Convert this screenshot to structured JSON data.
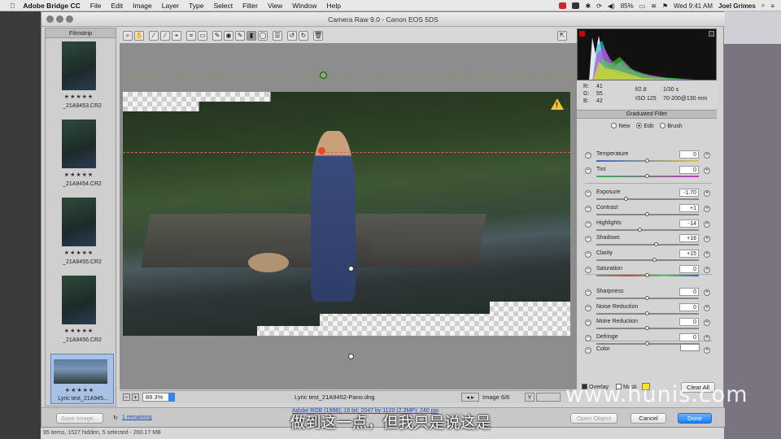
{
  "menubar": {
    "app_name": "Adobe Bridge CC",
    "items": [
      "File",
      "Edit",
      "Image",
      "Layer",
      "Type",
      "Select",
      "Filter",
      "View",
      "Window",
      "Help"
    ],
    "battery": "85%",
    "clock": "Wed 9:41 AM",
    "user": "Joel Grimes"
  },
  "window": {
    "title": "Camera Raw 9.0  -  Canon EOS 5DS"
  },
  "filmstrip": {
    "header": "Filmstrip",
    "items": [
      {
        "name": "_21A9453.CR2",
        "stars": "★★★★★"
      },
      {
        "name": "_21A9454.CR2",
        "stars": "★★★★★"
      },
      {
        "name": "_21A9455.CR2",
        "stars": "★★★★★"
      },
      {
        "name": "_21A9456.CR2",
        "stars": "★★★★★"
      },
      {
        "name": "Lyric test_21A945...",
        "stars": "★★★★★"
      }
    ]
  },
  "statusbar": {
    "zoom": "89.3%",
    "filename": "Lyric test_21A9452-Pano.dng",
    "image_count": "Image 6/6"
  },
  "rgb": {
    "r_label": "R:",
    "r": "41",
    "g_label": "G:",
    "g": "55",
    "b_label": "B:",
    "b": "42",
    "aperture": "f/2.8",
    "shutter": "1/30 s",
    "iso": "ISO 125",
    "lens": "70-200@130 mm"
  },
  "panel": {
    "title": "Graduated Filter",
    "modes": [
      "New",
      "Edit",
      "Brush"
    ],
    "selected_mode": "Edit",
    "sliders": [
      {
        "label": "Temperature",
        "value": "0",
        "pos": 0.5
      },
      {
        "label": "Tint",
        "value": "0",
        "pos": 0.5
      },
      {
        "label": "Exposure",
        "value": "-1.70",
        "pos": 0.29
      },
      {
        "label": "Contrast",
        "value": "+1",
        "pos": 0.5
      },
      {
        "label": "Highlights",
        "value": "-14",
        "pos": 0.43
      },
      {
        "label": "Shadows",
        "value": "+18",
        "pos": 0.59
      },
      {
        "label": "Clarity",
        "value": "+15",
        "pos": 0.57
      },
      {
        "label": "Saturation",
        "value": "0",
        "pos": 0.5
      },
      {
        "label": "Sharpness",
        "value": "0",
        "pos": 0.5
      },
      {
        "label": "Noise Reduction",
        "value": "0",
        "pos": 0.5
      },
      {
        "label": "Moire Reduction",
        "value": "0",
        "pos": 0.5
      },
      {
        "label": "Defringe",
        "value": "0",
        "pos": 0.5
      }
    ],
    "color_label": "Color",
    "overlay_label": "Overlay",
    "mask_label": "Mask",
    "clear_all": "Clear All"
  },
  "bottom": {
    "save_image": "Save Image...",
    "remaining": "1 remaining",
    "workflow_link": "Adobe RGB (1998); 16 bit; 2047 by 1120 (2.3MP); 240 ppi",
    "open_object": "Open Object",
    "cancel": "Cancel",
    "done": "Done"
  },
  "bridge_status": "95 items, 1527 hidden, 5 selected - 260.17 MB",
  "subtitle": "做到这一点，但我只是说这是",
  "watermark": "www.hunis.com"
}
